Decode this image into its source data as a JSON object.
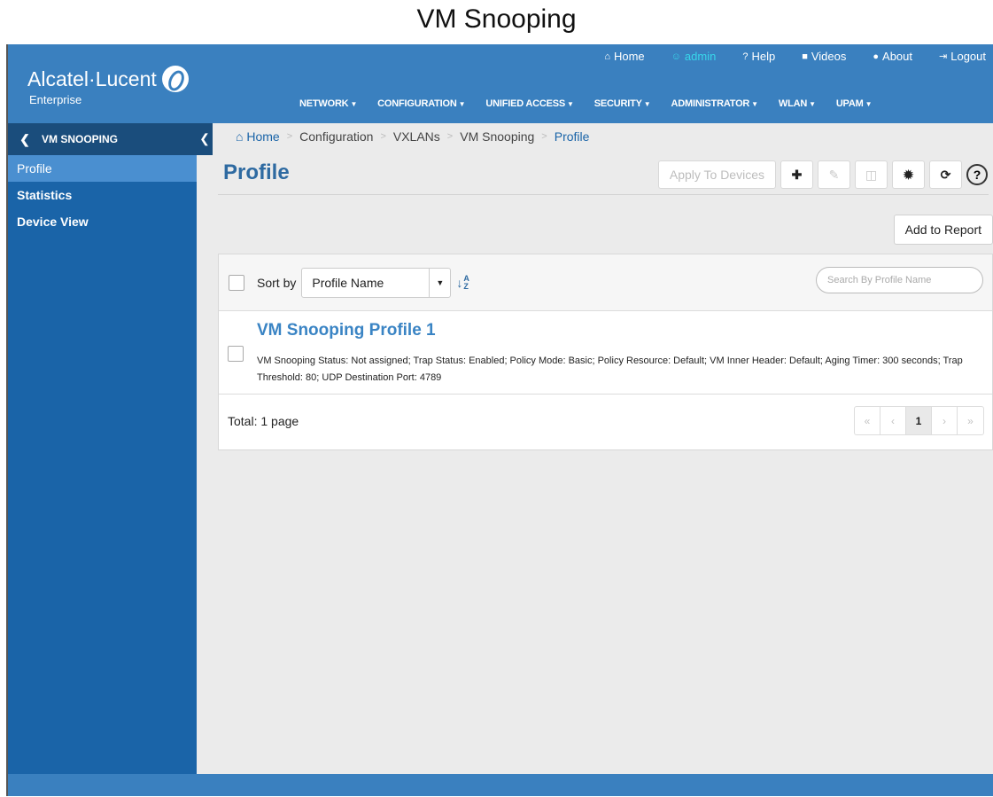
{
  "doc_title": "VM Snooping",
  "brand": {
    "name": "Alcatel·Lucent",
    "sub": "Enterprise"
  },
  "top_links": [
    {
      "icon": "home-icon",
      "glyph": "⌂",
      "label": "Home",
      "active": false
    },
    {
      "icon": "user-icon",
      "glyph": "☺",
      "label": "admin",
      "active": true
    },
    {
      "icon": "help-icon",
      "glyph": "?",
      "label": "Help",
      "active": false
    },
    {
      "icon": "video-icon",
      "glyph": "■",
      "label": "Videos",
      "active": false
    },
    {
      "icon": "info-icon",
      "glyph": "●",
      "label": "About",
      "active": false
    },
    {
      "icon": "logout-icon",
      "glyph": "⇥",
      "label": "Logout",
      "active": false
    }
  ],
  "main_nav": [
    "NETWORK",
    "CONFIGURATION",
    "UNIFIED ACCESS",
    "SECURITY",
    "ADMINISTRATOR",
    "WLAN",
    "UPAM"
  ],
  "sidebar": {
    "title": "VM SNOOPING",
    "items": [
      {
        "label": "Profile",
        "active": true
      },
      {
        "label": "Statistics",
        "active": false
      },
      {
        "label": "Device View",
        "active": false
      }
    ]
  },
  "breadcrumb": {
    "home": "Home",
    "items": [
      "Configuration",
      "VXLANs",
      "VM Snooping"
    ],
    "current": "Profile"
  },
  "page": {
    "title": "Profile"
  },
  "toolbar": {
    "apply_label": "Apply To Devices",
    "help": "?"
  },
  "add_report_label": "Add to Report",
  "sort": {
    "label": "Sort by",
    "value": "Profile Name"
  },
  "search": {
    "placeholder": "Search By Profile Name"
  },
  "rows": [
    {
      "title": "VM Snooping Profile 1",
      "description": "VM Snooping Status: Not assigned; Trap Status: Enabled; Policy Mode: Basic; Policy Resource: Default; VM Inner Header: Default; Aging Timer: 300 seconds; Trap Threshold: 80; UDP Destination Port: 4789"
    }
  ],
  "footer": {
    "total": "Total: 1 page"
  },
  "pager": {
    "first": "«",
    "prev": "‹",
    "current": "1",
    "next": "›",
    "last": "»"
  }
}
